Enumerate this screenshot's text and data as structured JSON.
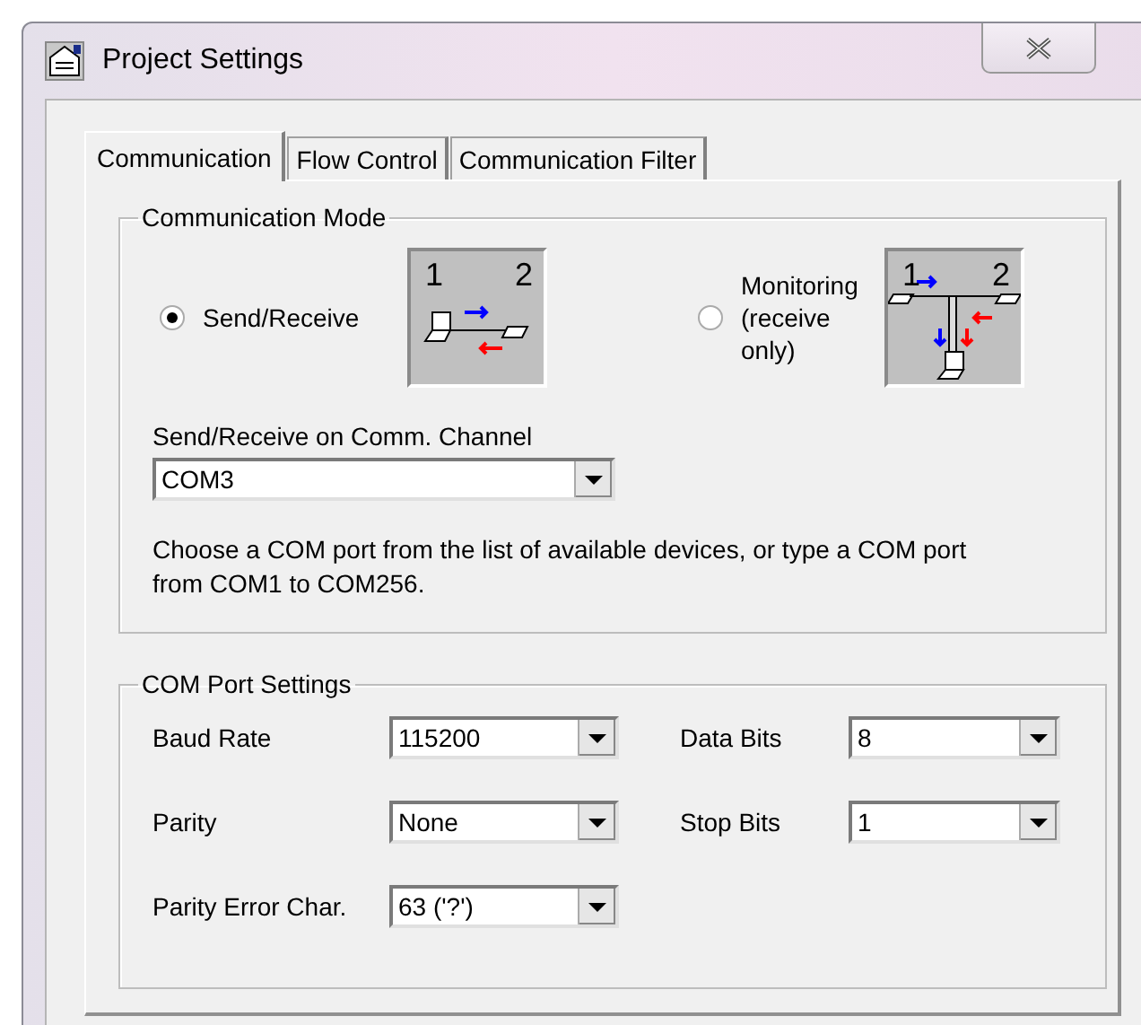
{
  "window": {
    "title": "Project Settings"
  },
  "tabs": [
    {
      "label": "Communication",
      "selected": true
    },
    {
      "label": "Flow Control",
      "selected": false
    },
    {
      "label": "Communication Filter",
      "selected": false
    }
  ],
  "communication_mode": {
    "title": "Communication Mode",
    "options": [
      {
        "label": "Send/Receive",
        "selected": true,
        "kind": "direct",
        "diagram_labels": [
          "1",
          "2"
        ]
      },
      {
        "label": "Monitoring (receive only)",
        "selected": false,
        "kind": "tap",
        "diagram_labels": [
          "1",
          "2"
        ]
      }
    ],
    "channel_label": "Send/Receive on Comm. Channel",
    "channel_value": "COM3",
    "hint": "Choose a COM port from the list of available devices, or type a COM port from COM1 to COM256."
  },
  "com_port_settings": {
    "title": "COM Port Settings",
    "fields": [
      {
        "label": "Baud Rate",
        "value": "115200"
      },
      {
        "label": "Data Bits",
        "value": "8"
      },
      {
        "label": "Parity",
        "value": "None"
      },
      {
        "label": "Stop Bits",
        "value": "1"
      },
      {
        "label": "Parity Error Char.",
        "value": "63 ('?')"
      }
    ]
  }
}
